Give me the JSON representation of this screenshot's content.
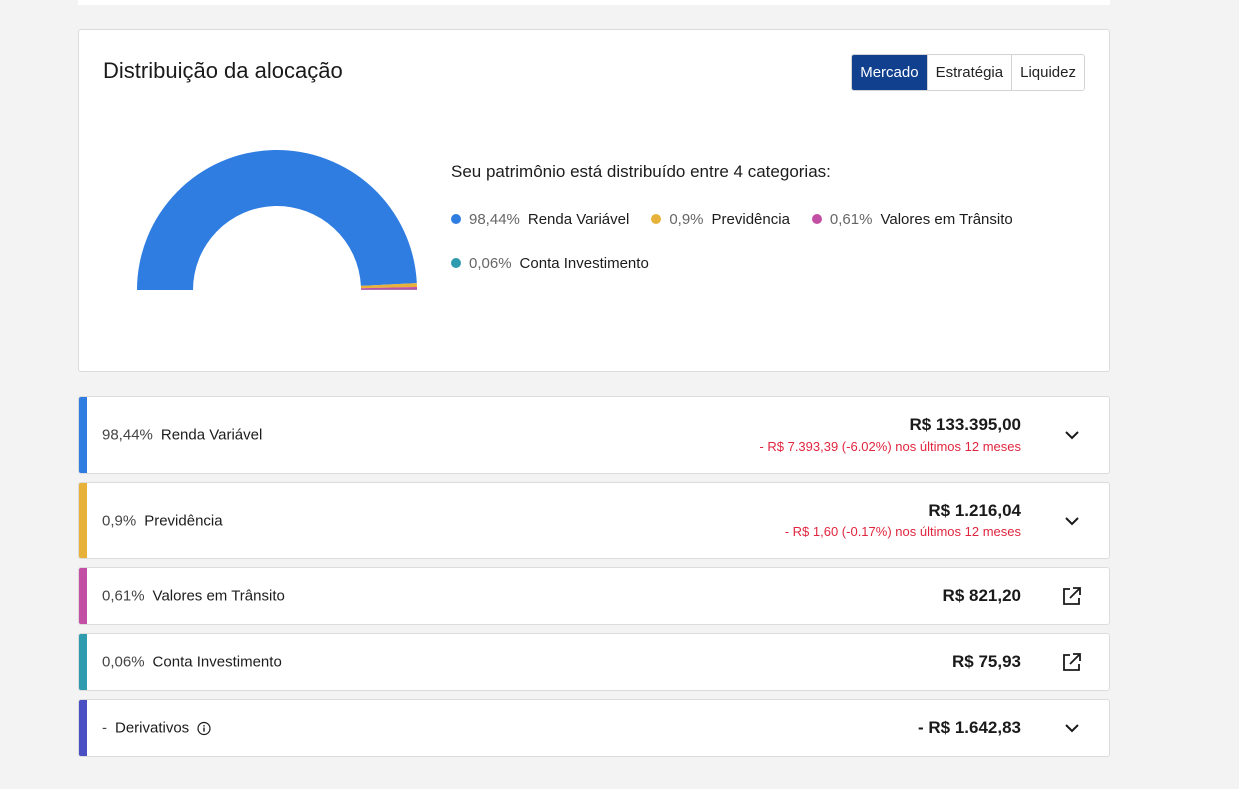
{
  "card": {
    "title": "Distribuição da alocação",
    "tabs": [
      {
        "label": "Mercado",
        "active": true
      },
      {
        "label": "Estratégia",
        "active": false
      },
      {
        "label": "Liquidez",
        "active": false
      }
    ],
    "distribution_text": "Seu patrimônio está distribuído entre 4 categorias:",
    "legend": [
      {
        "pct": "98,44%",
        "name": "Renda Variável",
        "color": "#2f7de1"
      },
      {
        "pct": "0,9%",
        "name": "Previdência",
        "color": "#e8b23a"
      },
      {
        "pct": "0,61%",
        "name": "Valores em Trânsito",
        "color": "#c24fa3"
      },
      {
        "pct": "0,06%",
        "name": "Conta Investimento",
        "color": "#2e9bae"
      }
    ]
  },
  "chart_data": {
    "type": "pie",
    "style": "semi-donut",
    "categories": [
      "Renda Variável",
      "Previdência",
      "Valores em Trânsito",
      "Conta Investimento"
    ],
    "values": [
      98.44,
      0.9,
      0.61,
      0.06
    ],
    "colors": [
      "#2f7de1",
      "#e8b23a",
      "#c24fa3",
      "#2e9bae"
    ]
  },
  "rows": [
    {
      "pct": "98,44%",
      "name": "Renda Variável",
      "amount": "R$ 133.395,00",
      "sub": "- R$ 7.393,39 (-6.02%) nos últimos 12 meses",
      "color": "#2f7de1",
      "action": "chevron-down-icon"
    },
    {
      "pct": "0,9%",
      "name": "Previdência",
      "amount": "R$ 1.216,04",
      "sub": "- R$ 1,60 (-0.17%) nos últimos 12 meses",
      "color": "#e8b23a",
      "action": "chevron-down-icon"
    },
    {
      "pct": "0,61%",
      "name": "Valores em Trânsito",
      "amount": "R$ 821,20",
      "sub": "",
      "color": "#c24fa3",
      "action": "external-link-icon"
    },
    {
      "pct": "0,06%",
      "name": "Conta Investimento",
      "amount": "R$ 75,93",
      "sub": "",
      "color": "#2e9bae",
      "action": "external-link-icon"
    },
    {
      "pct": "-",
      "name": "Derivativos",
      "amount": "- R$ 1.642,83",
      "sub": "",
      "color": "#4a4fc4",
      "action": "chevron-down-icon",
      "info": "info-icon"
    }
  ]
}
